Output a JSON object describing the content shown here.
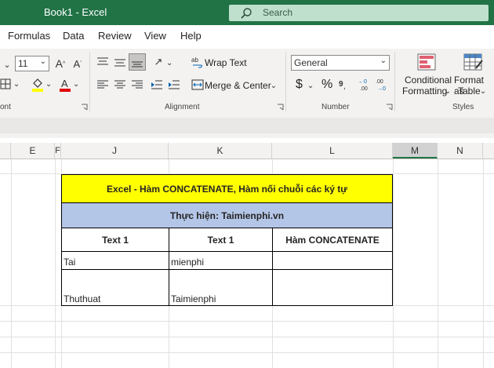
{
  "window": {
    "title": "Book1  -  Excel"
  },
  "search": {
    "label": "Search"
  },
  "menu": {
    "items": [
      "Formulas",
      "Data",
      "Review",
      "View",
      "Help"
    ]
  },
  "ribbon": {
    "font": {
      "size": "11",
      "group_label": "ont"
    },
    "alignment": {
      "wrap_text": "Wrap Text",
      "merge_center": "Merge & Center",
      "group_label": "Alignment"
    },
    "number": {
      "format": "General",
      "currency": "$",
      "percent": "%",
      "group_label": "Number"
    },
    "styles": {
      "conditional_line1": "Conditional",
      "conditional_line2": "Formatting",
      "format_table_line1": "Format as",
      "format_table_line2": "Table",
      "group_label": "Styles"
    }
  },
  "columns": [
    "E",
    "F",
    "J",
    "K",
    "L",
    "M",
    "N"
  ],
  "table": {
    "title": "Excel - Hàm CONCATENATE, Hàm nối chuỗi các ký tự",
    "subtitle": "Thực hiện: Taimienphi.vn",
    "headers": [
      "Text 1",
      "Text 1",
      "Hàm CONCATENATE"
    ],
    "rows": [
      [
        "Tai",
        "mienphi",
        ""
      ],
      [
        "Thuthuat",
        "Taimienphi",
        ""
      ]
    ]
  },
  "colors": {
    "title_bar": "#217346",
    "title_fill": "#ffff00",
    "subtitle_fill": "#b4c6e7",
    "selected_col": "#d2d2d2"
  }
}
